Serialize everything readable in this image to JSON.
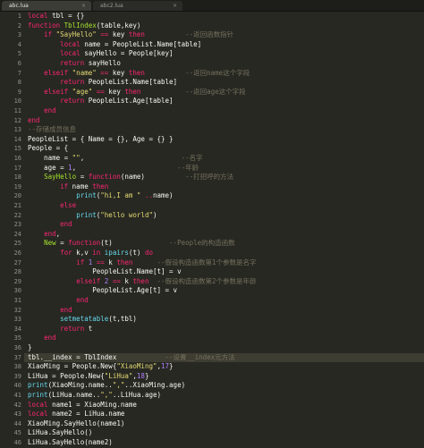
{
  "tabs": [
    {
      "label": "abc.lua",
      "active": true
    },
    {
      "label": "abc2.lua",
      "active": false
    }
  ],
  "highlight_line": 37,
  "lines": [
    [
      [
        "kw",
        "local"
      ],
      [
        "id",
        " tbl = {}"
      ]
    ],
    [
      [
        "kw",
        "function"
      ],
      [
        "fn",
        " TblIndex"
      ],
      [
        "id",
        "(table,key)"
      ]
    ],
    [
      [
        "id",
        "    "
      ],
      [
        "kw",
        "if"
      ],
      [
        "str",
        " \"SayHello\""
      ],
      [
        "kw",
        " =="
      ],
      [
        "id",
        " key "
      ],
      [
        "kw",
        "then"
      ],
      [
        "cm",
        "          --返回函数指针"
      ]
    ],
    [
      [
        "id",
        "        "
      ],
      [
        "kw",
        "local"
      ],
      [
        "id",
        " name = PeopleList.Name[table]"
      ]
    ],
    [
      [
        "id",
        "        "
      ],
      [
        "kw",
        "local"
      ],
      [
        "id",
        " sayHello = People[key]"
      ]
    ],
    [
      [
        "id",
        "        "
      ],
      [
        "kw",
        "return"
      ],
      [
        "id",
        " sayHello"
      ]
    ],
    [
      [
        "id",
        "    "
      ],
      [
        "kw",
        "elseif"
      ],
      [
        "str",
        " \"name\""
      ],
      [
        "kw",
        " =="
      ],
      [
        "id",
        " key "
      ],
      [
        "kw",
        "then"
      ],
      [
        "cm",
        "          --返回name这个字段"
      ]
    ],
    [
      [
        "id",
        "        "
      ],
      [
        "kw",
        "return"
      ],
      [
        "id",
        " PeopleList.Name[table]"
      ]
    ],
    [
      [
        "id",
        "    "
      ],
      [
        "kw",
        "elseif"
      ],
      [
        "str",
        " \"age\""
      ],
      [
        "kw",
        " =="
      ],
      [
        "id",
        " key "
      ],
      [
        "kw",
        "then"
      ],
      [
        "cm",
        "           --返回age这个字段"
      ]
    ],
    [
      [
        "id",
        "        "
      ],
      [
        "kw",
        "return"
      ],
      [
        "id",
        " PeopleList.Age[table]"
      ]
    ],
    [
      [
        "id",
        "    "
      ],
      [
        "kw",
        "end"
      ]
    ],
    [
      [
        "kw",
        "end"
      ]
    ],
    [
      [
        "cm",
        "--存储成员信息"
      ]
    ],
    [
      [
        "id",
        "PeopleList = { Name = {}, Age = {} }"
      ]
    ],
    [
      [
        "id",
        "People = {"
      ]
    ],
    [
      [
        "id",
        "    name = "
      ],
      [
        "str",
        "\"\""
      ],
      [
        "id",
        ","
      ],
      [
        "cm",
        "                        --名字"
      ]
    ],
    [
      [
        "id",
        "    age = "
      ],
      [
        "num",
        "1"
      ],
      [
        "id",
        ","
      ],
      [
        "cm",
        "                         --年龄"
      ]
    ],
    [
      [
        "id",
        "    "
      ],
      [
        "fn",
        "SayHello"
      ],
      [
        "id",
        " = "
      ],
      [
        "kw",
        "function"
      ],
      [
        "id",
        "(name)"
      ],
      [
        "cm",
        "          --打招呼的方法"
      ]
    ],
    [
      [
        "id",
        "        "
      ],
      [
        "kw",
        "if"
      ],
      [
        "id",
        " name "
      ],
      [
        "kw",
        "then"
      ]
    ],
    [
      [
        "id",
        "            "
      ],
      [
        "bi",
        "print"
      ],
      [
        "id",
        "("
      ],
      [
        "str",
        "\"hi,I am \""
      ],
      [
        "kw",
        " .."
      ],
      [
        "id",
        "name)"
      ]
    ],
    [
      [
        "id",
        "        "
      ],
      [
        "kw",
        "else"
      ]
    ],
    [
      [
        "id",
        "            "
      ],
      [
        "bi",
        "print"
      ],
      [
        "id",
        "("
      ],
      [
        "str",
        "\"hello world\""
      ],
      [
        "id",
        ")"
      ]
    ],
    [
      [
        "id",
        "        "
      ],
      [
        "kw",
        "end"
      ]
    ],
    [
      [
        "id",
        "    "
      ],
      [
        "kw",
        "end"
      ],
      [
        "id",
        ","
      ]
    ],
    [
      [
        "id",
        "    "
      ],
      [
        "fn",
        "New"
      ],
      [
        "id",
        " = "
      ],
      [
        "kw",
        "function"
      ],
      [
        "id",
        "(t)"
      ],
      [
        "cm",
        "              --People的构造函数"
      ]
    ],
    [
      [
        "id",
        "        "
      ],
      [
        "kw",
        "for"
      ],
      [
        "id",
        " k,v "
      ],
      [
        "kw",
        "in"
      ],
      [
        "bi",
        " ipairs"
      ],
      [
        "id",
        "(t) "
      ],
      [
        "kw",
        "do"
      ]
    ],
    [
      [
        "id",
        "            "
      ],
      [
        "kw",
        "if"
      ],
      [
        "num",
        " 1"
      ],
      [
        "kw",
        " =="
      ],
      [
        "id",
        " k "
      ],
      [
        "kw",
        "then"
      ],
      [
        "cm",
        "      --假设构造函数第1个参数是名字"
      ]
    ],
    [
      [
        "id",
        "                PeopleList.Name[t] = v"
      ]
    ],
    [
      [
        "id",
        "            "
      ],
      [
        "kw",
        "elseif"
      ],
      [
        "num",
        " 2"
      ],
      [
        "kw",
        " =="
      ],
      [
        "id",
        " k "
      ],
      [
        "kw",
        "then"
      ],
      [
        "cm",
        "  --假设构造函数第2个参数是年龄"
      ]
    ],
    [
      [
        "id",
        "                PeopleList.Age[t] = v"
      ]
    ],
    [
      [
        "id",
        "            "
      ],
      [
        "kw",
        "end"
      ]
    ],
    [
      [
        "id",
        "        "
      ],
      [
        "kw",
        "end"
      ]
    ],
    [
      [
        "id",
        "        "
      ],
      [
        "bi",
        "setmetatable"
      ],
      [
        "id",
        "(t,tbl)"
      ]
    ],
    [
      [
        "id",
        "        "
      ],
      [
        "kw",
        "return"
      ],
      [
        "id",
        " t"
      ]
    ],
    [
      [
        "id",
        "    "
      ],
      [
        "kw",
        "end"
      ]
    ],
    [
      [
        "id",
        "}"
      ]
    ],
    [
      [
        "id",
        "tbl.__index = TblIndex"
      ],
      [
        "cm",
        "            --设置__index元方法"
      ]
    ],
    [
      [
        "id",
        "XiaoMing = People.New{"
      ],
      [
        "str",
        "\"XiaoMing\""
      ],
      [
        "id",
        ","
      ],
      [
        "num",
        "17"
      ],
      [
        "id",
        "}"
      ]
    ],
    [
      [
        "id",
        "LiHua = People.New{"
      ],
      [
        "str",
        "\"LiHua\""
      ],
      [
        "id",
        ","
      ],
      [
        "num",
        "18"
      ],
      [
        "id",
        "}"
      ]
    ],
    [
      [
        "bi",
        "print"
      ],
      [
        "id",
        "(XiaoMing.name.."
      ],
      [
        "str",
        "\",\""
      ],
      [
        "id",
        "..XiaoMing.age)"
      ]
    ],
    [
      [
        "bi",
        "print"
      ],
      [
        "id",
        "(LiHua.name.."
      ],
      [
        "str",
        "\",\""
      ],
      [
        "id",
        "..LiHua.age)"
      ]
    ],
    [
      [
        "kw",
        "local"
      ],
      [
        "id",
        " name1 = XiaoMing.name"
      ]
    ],
    [
      [
        "kw",
        "local"
      ],
      [
        "id",
        " name2 = LiHua.name"
      ]
    ],
    [
      [
        "id",
        "XiaoMing.SayHello(name1)"
      ]
    ],
    [
      [
        "id",
        "LiHua.SayHello()"
      ]
    ],
    [
      [
        "id",
        "LiHua.SayHello(name2)"
      ]
    ]
  ],
  "colors": {
    "background": "#272822",
    "keyword": "#f92672",
    "string": "#e6db74",
    "number": "#ae81ff",
    "function": "#a6e22e",
    "comment": "#75715e",
    "builtin": "#66d9ef",
    "text": "#f8f8f2"
  }
}
